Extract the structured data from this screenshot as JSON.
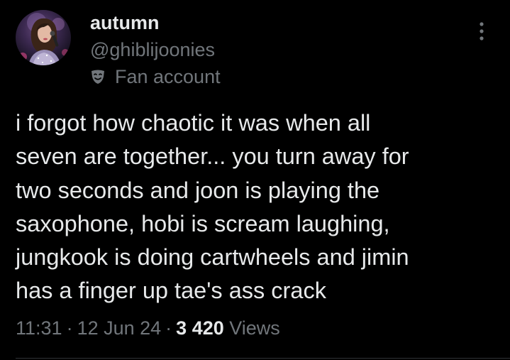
{
  "author": {
    "display_name": "autumn",
    "handle": "@ghiblijoonies",
    "account_label": "Fan account"
  },
  "tweet": {
    "lines": [
      "i forgot how chaotic it was when all",
      "seven are together... you turn away for",
      "two seconds and joon is playing the",
      "saxophone, hobi is scream laughing,",
      "jungkook is doing cartwheels and jimin",
      "has a finger up tae's ass crack"
    ]
  },
  "meta": {
    "time": "11:31",
    "separator": "·",
    "date": "12 Jun 24",
    "views_count": "3 420",
    "views_label": "Views"
  },
  "icons": {
    "more": "more-vertical-icon",
    "fan_account": "theater-mask-icon"
  },
  "colors": {
    "background": "#000000",
    "primary_text": "#e7e9ea",
    "secondary_text": "#71767b",
    "divider": "#2f3336"
  }
}
